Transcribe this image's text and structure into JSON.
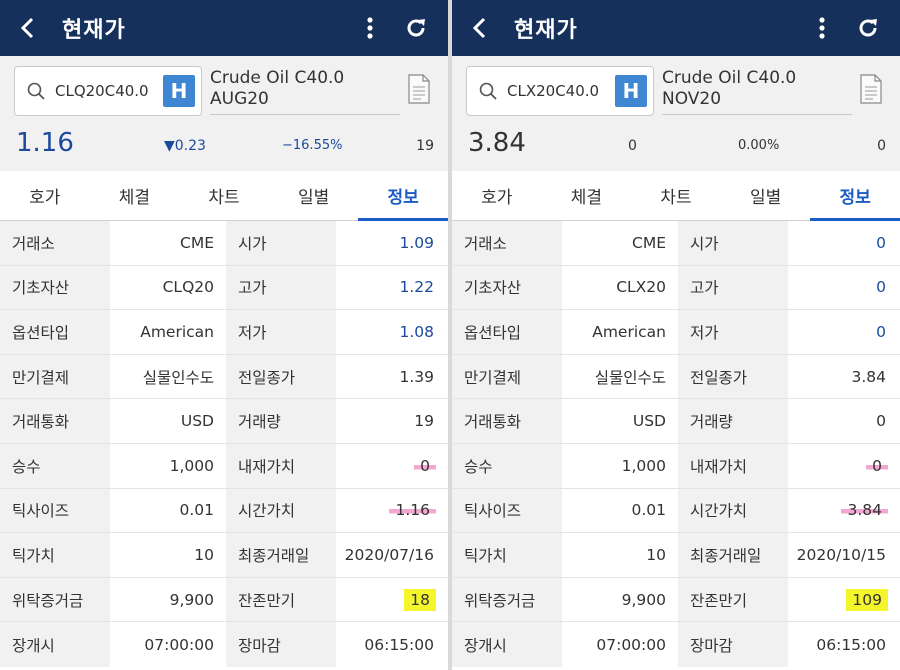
{
  "panels": [
    {
      "header": {
        "title": "현재가"
      },
      "search": {
        "code": "CLQ20C40.0",
        "badge": "H"
      },
      "instrument_name": [
        "Crude Oil C40.0",
        "AUG20"
      ],
      "quote": {
        "price": "1.16",
        "change": "▼0.23",
        "change_pct": "−16.55%",
        "volume": "19"
      },
      "tabs": [
        "호가",
        "체결",
        "차트",
        "일별",
        "정보"
      ],
      "active_tab": 4,
      "rows": [
        {
          "l1": "거래소",
          "v1": "CME",
          "l2": "시가",
          "v2": "1.09"
        },
        {
          "l1": "기초자산",
          "v1": "CLQ20",
          "l2": "고가",
          "v2": "1.22"
        },
        {
          "l1": "옵션타입",
          "v1": "American",
          "l2": "저가",
          "v2": "1.08"
        },
        {
          "l1": "만기결제",
          "v1": "실물인수도",
          "l2": "전일종가",
          "v2": "1.39"
        },
        {
          "l1": "거래통화",
          "v1": "USD",
          "l2": "거래량",
          "v2": "19"
        },
        {
          "l1": "승수",
          "v1": "1,000",
          "l2": "내재가치",
          "v2": "0"
        },
        {
          "l1": "틱사이즈",
          "v1": "0.01",
          "l2": "시간가치",
          "v2": "1.16"
        },
        {
          "l1": "틱가치",
          "v1": "10",
          "l2": "최종거래일",
          "v2": "2020/07/16"
        },
        {
          "l1": "위탁증거금",
          "v1": "9,900",
          "l2": "잔존만기",
          "v2": "18"
        },
        {
          "l1": "장개시",
          "v1": "07:00:00",
          "l2": "장마감",
          "v2": "06:15:00"
        }
      ]
    },
    {
      "header": {
        "title": "현재가"
      },
      "search": {
        "code": "CLX20C40.0",
        "badge": "H"
      },
      "instrument_name": [
        "Crude Oil C40.0",
        "NOV20"
      ],
      "quote": {
        "price": "3.84",
        "change": "0",
        "change_pct": "0.00%",
        "volume": "0"
      },
      "tabs": [
        "호가",
        "체결",
        "차트",
        "일별",
        "정보"
      ],
      "active_tab": 4,
      "rows": [
        {
          "l1": "거래소",
          "v1": "CME",
          "l2": "시가",
          "v2": "0"
        },
        {
          "l1": "기초자산",
          "v1": "CLX20",
          "l2": "고가",
          "v2": "0"
        },
        {
          "l1": "옵션타입",
          "v1": "American",
          "l2": "저가",
          "v2": "0"
        },
        {
          "l1": "만기결제",
          "v1": "실물인수도",
          "l2": "전일종가",
          "v2": "3.84"
        },
        {
          "l1": "거래통화",
          "v1": "USD",
          "l2": "거래량",
          "v2": "0"
        },
        {
          "l1": "승수",
          "v1": "1,000",
          "l2": "내재가치",
          "v2": "0"
        },
        {
          "l1": "틱사이즈",
          "v1": "0.01",
          "l2": "시간가치",
          "v2": "3.84"
        },
        {
          "l1": "틱가치",
          "v1": "10",
          "l2": "최종거래일",
          "v2": "2020/10/15"
        },
        {
          "l1": "위탁증거금",
          "v1": "9,900",
          "l2": "잔존만기",
          "v2": "109"
        },
        {
          "l1": "장개시",
          "v1": "07:00:00",
          "l2": "장마감",
          "v2": "06:15:00"
        }
      ]
    }
  ],
  "colors": {
    "header_bg": "#16305c",
    "accent_blue": "#1b5cc4",
    "badge_blue": "#3f87d3",
    "highlight_yellow": "#f5f52b",
    "highlight_pink": "#f2a8d0"
  },
  "icons": [
    "back-icon",
    "more-vert-icon",
    "refresh-icon",
    "search-icon",
    "document-icon"
  ]
}
